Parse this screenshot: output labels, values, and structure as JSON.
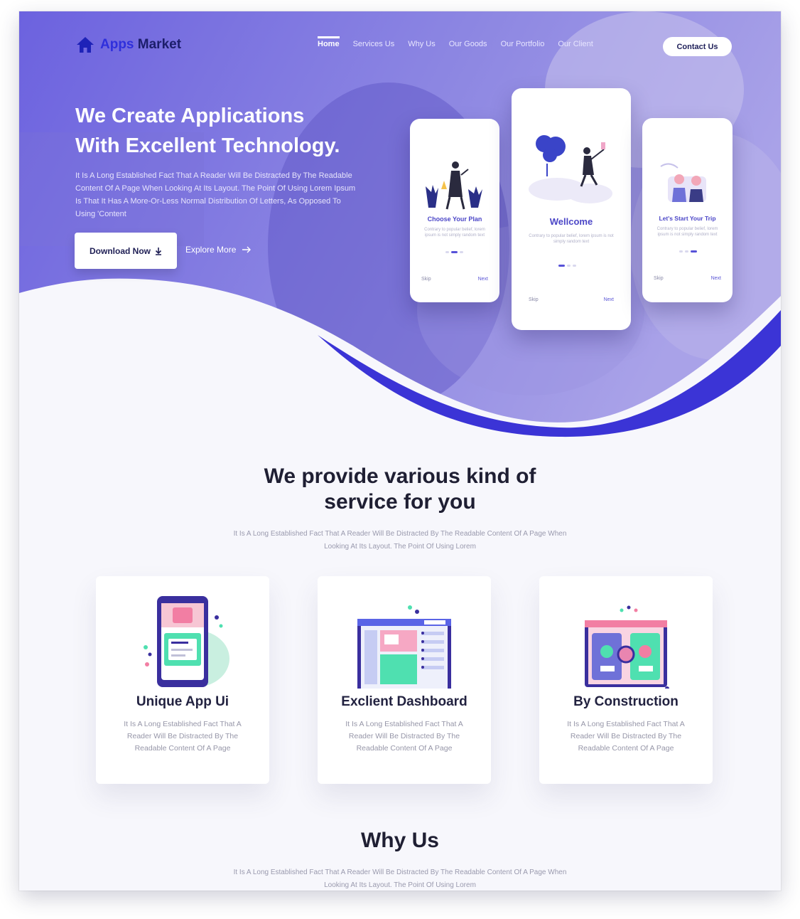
{
  "brand": {
    "name_part1": "Apps",
    "name_part2": "Market",
    "icon": "home-icon"
  },
  "nav": {
    "links": [
      "Home",
      "Services Us",
      "Why Us",
      "Our Goods",
      "Our Portfolio",
      "Our Client"
    ],
    "active_index": 0,
    "contact_label": "Contact Us"
  },
  "hero": {
    "title_line1": "We Create Applications",
    "title_line2": "With Excellent Technology.",
    "description": "It Is A Long Established Fact That A Reader Will Be Distracted By The Readable Content Of A Page When Looking At Its Layout. The Point Of Using Lorem Ipsum Is That It Has A More-Or-Less Normal Distribution Of Letters, As Opposed To Using 'Content",
    "download_label": "Download Now",
    "download_icon": "download-arrow-icon",
    "explore_label": "Explore More",
    "explore_icon": "arrow-right-icon"
  },
  "phones": [
    {
      "title": "Choose Your Plan",
      "desc": "Contrary to popular belief, lorem ipsum is not simply random text",
      "skip": "Skip",
      "next": "Next"
    },
    {
      "title": "Wellcome",
      "desc": "Contrary to popular belief, lorem ipsum is not simply random text",
      "skip": "Skip",
      "next": "Next"
    },
    {
      "title": "Let's Start Your Trip",
      "desc": "Contrary to popular belief, lorem ipsum is not simply random text",
      "skip": "Skip",
      "next": "Next"
    }
  ],
  "services": {
    "title_line1": "We provide various kind of",
    "title_line2": "service for you",
    "description": "It Is A Long Established Fact That A Reader Will Be Distracted By The Readable Content Of A Page When Looking At Its Layout. The Point Of Using Lorem",
    "cards": [
      {
        "title": "Unique App Ui",
        "desc": "It Is A Long Established Fact That A Reader Will Be Distracted By The Readable Content Of A Page",
        "icon": "mobile-app-illustration"
      },
      {
        "title": "Exclient Dashboard",
        "desc": "It Is A Long Established Fact That A Reader Will Be Distracted By The Readable Content Of A Page",
        "icon": "dashboard-illustration"
      },
      {
        "title": "By Construction",
        "desc": "It Is A Long Established Fact That A Reader Will Be Distracted By The Readable Content Of A Page",
        "icon": "construction-illustration"
      }
    ]
  },
  "why_us": {
    "title": "Why Us",
    "description": "It Is A Long Established Fact That A Reader Will Be Distracted By The Readable Content Of A Page When Looking At Its Layout. The Point Of Using Lorem"
  },
  "colors": {
    "primary": "#3b34d6",
    "hero_overlay": "#6a5fe0",
    "dark_text": "#1f1f33",
    "muted_text": "#9a9aae"
  }
}
